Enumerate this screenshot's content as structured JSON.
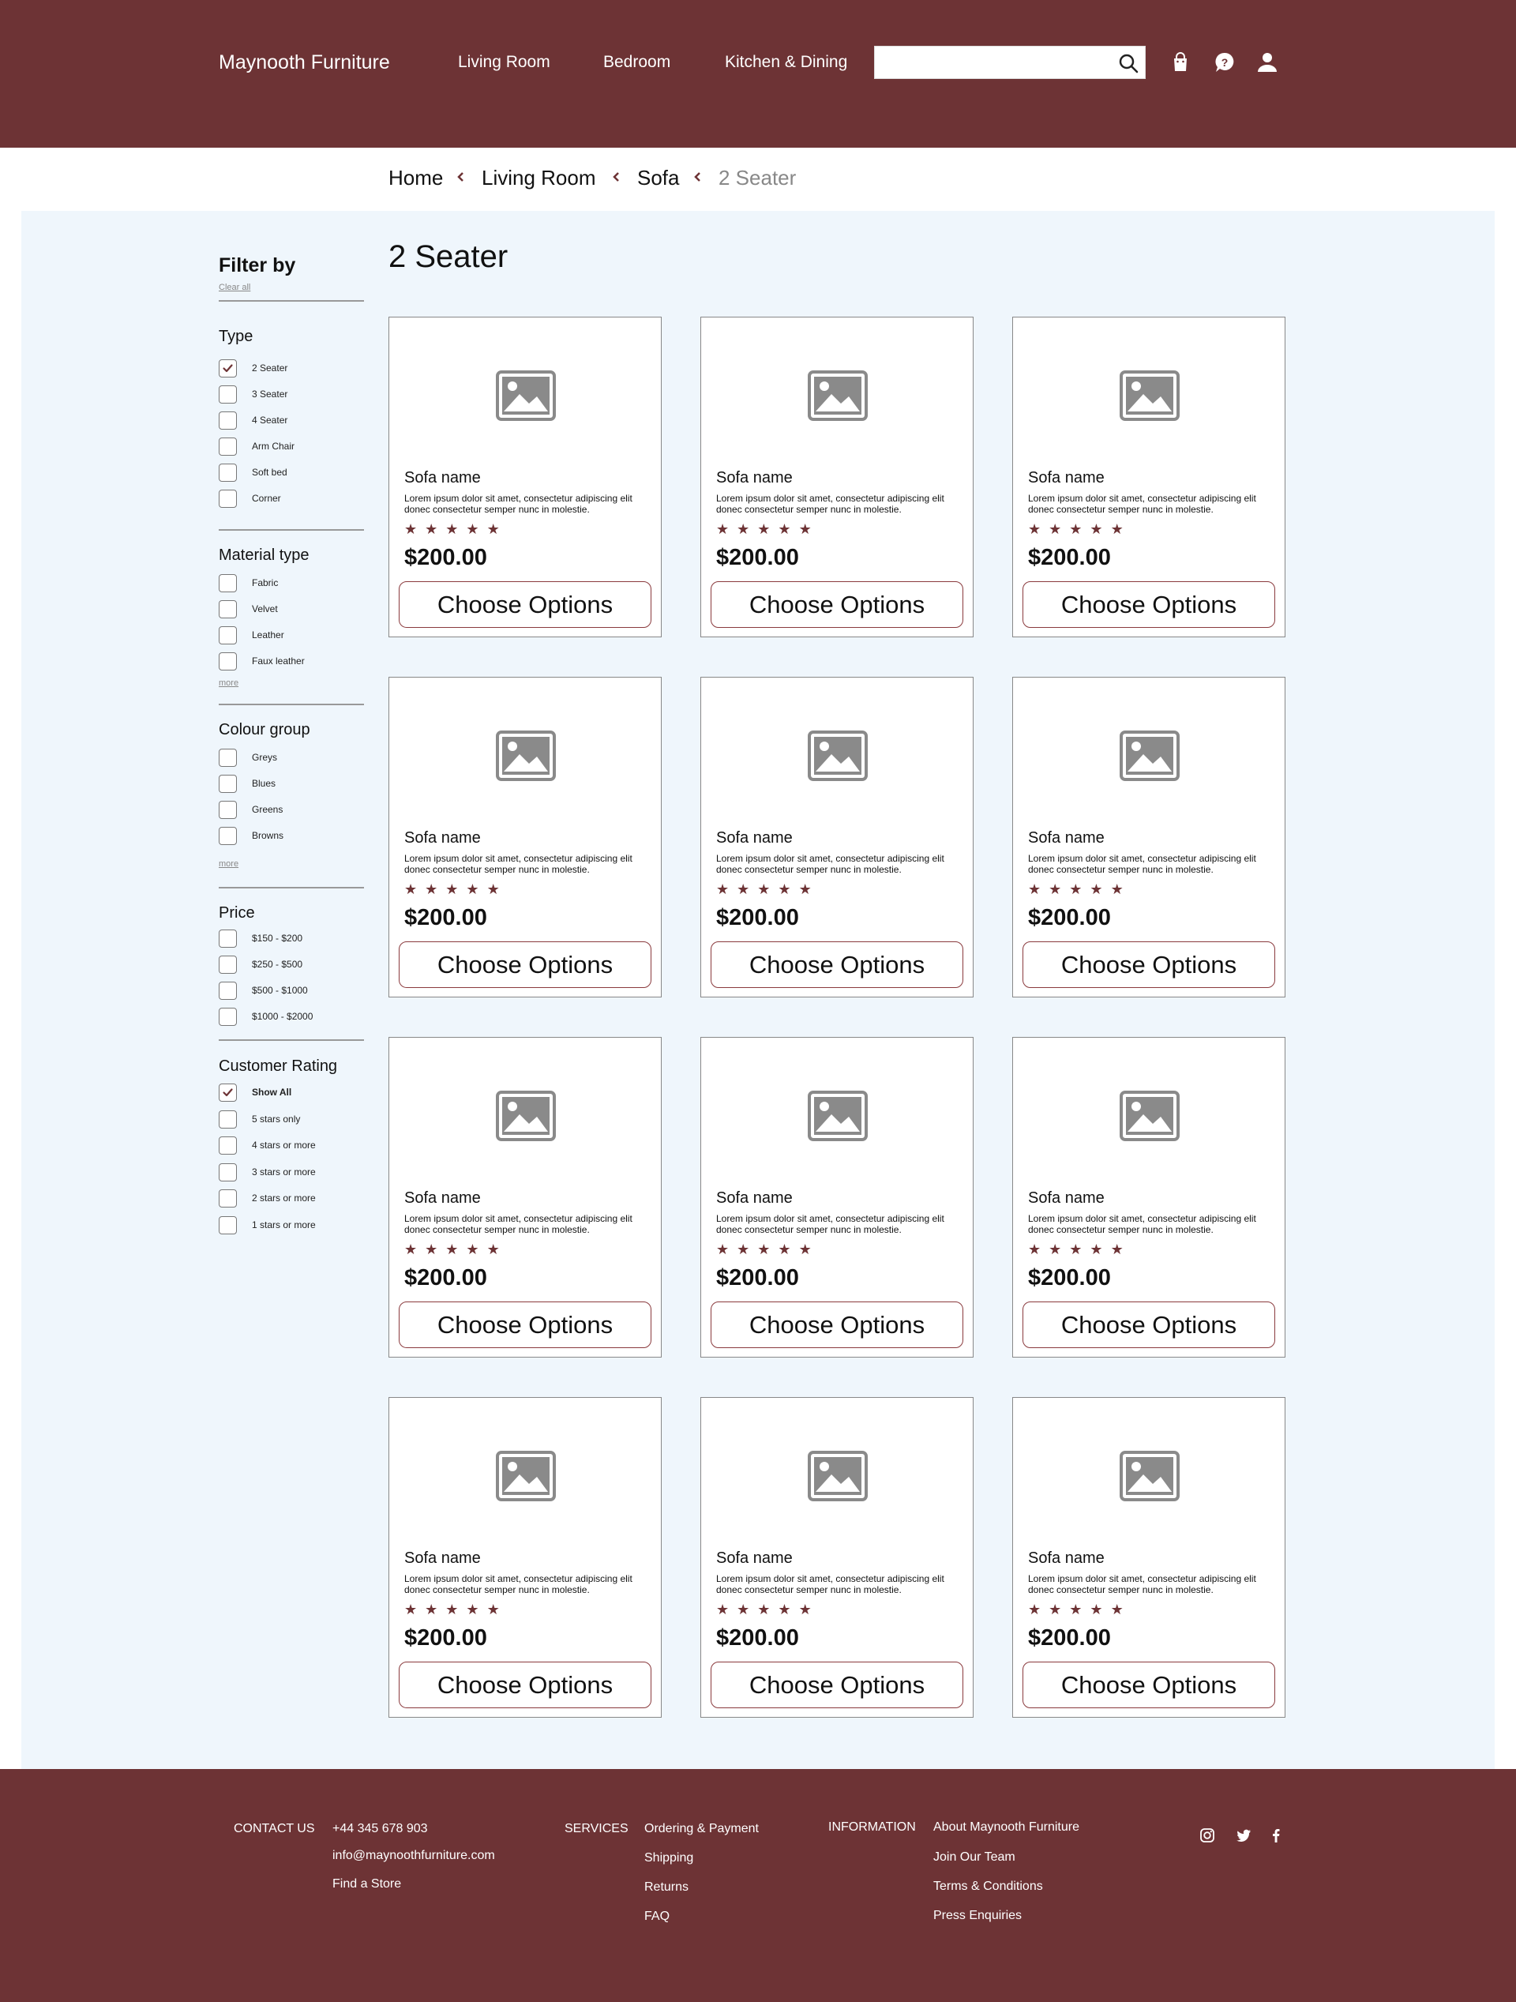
{
  "header": {
    "brand": "Maynooth Furniture",
    "nav": [
      "Living Room",
      "Bedroom",
      "Kitchen & Dining"
    ],
    "search": {
      "value": "",
      "placeholder": ""
    },
    "icons": [
      "search-icon",
      "shopping-bag-icon",
      "help-icon",
      "user-icon"
    ]
  },
  "breadcrumb": [
    "Home",
    "Living Room",
    "Sofa",
    "2 Seater"
  ],
  "page_title": "2 Seater",
  "filters": {
    "title": "Filter by",
    "clear_all": "Clear all",
    "more_label": "more",
    "type": {
      "title": "Type",
      "options": [
        {
          "label": "2 Seater",
          "checked": true
        },
        {
          "label": "3 Seater",
          "checked": false
        },
        {
          "label": "4 Seater",
          "checked": false
        },
        {
          "label": "Arm Chair",
          "checked": false
        },
        {
          "label": "Soft bed",
          "checked": false
        },
        {
          "label": "Corner",
          "checked": false
        }
      ]
    },
    "material": {
      "title": "Material type",
      "options": [
        {
          "label": "Fabric",
          "checked": false
        },
        {
          "label": "Velvet",
          "checked": false
        },
        {
          "label": "Leather",
          "checked": false
        },
        {
          "label": "Faux leather",
          "checked": false
        }
      ]
    },
    "colour": {
      "title": "Colour group",
      "options": [
        {
          "label": "Greys",
          "checked": false
        },
        {
          "label": "Blues",
          "checked": false
        },
        {
          "label": "Greens",
          "checked": false
        },
        {
          "label": "Browns",
          "checked": false
        }
      ]
    },
    "price": {
      "title": "Price",
      "options": [
        {
          "label": "$150 - $200",
          "checked": false
        },
        {
          "label": "$250 - $500",
          "checked": false
        },
        {
          "label": "$500 - $1000",
          "checked": false
        },
        {
          "label": "$1000 - $2000",
          "checked": false
        }
      ]
    },
    "rating": {
      "title": "Customer Rating",
      "options": [
        {
          "label": "Show All",
          "checked": true
        },
        {
          "label": "5 stars only",
          "checked": false
        },
        {
          "label": "4 stars or more",
          "checked": false
        },
        {
          "label": "3 stars or more",
          "checked": false
        },
        {
          "label": "2 stars or more",
          "checked": false
        },
        {
          "label": "1 stars or more",
          "checked": false
        }
      ]
    }
  },
  "products": [
    {
      "name": "Sofa name",
      "description": "Lorem ipsum dolor sit amet, consectetur adipiscing elit donec consectetur semper nunc in molestie.",
      "rating": 5,
      "price": "$200.00",
      "button": "Choose Options"
    },
    {
      "name": "Sofa name",
      "description": "Lorem ipsum dolor sit amet, consectetur adipiscing elit donec consectetur semper nunc in molestie.",
      "rating": 5,
      "price": "$200.00",
      "button": "Choose Options"
    },
    {
      "name": "Sofa name",
      "description": "Lorem ipsum dolor sit amet, consectetur adipiscing elit donec consectetur semper nunc in molestie.",
      "rating": 5,
      "price": "$200.00",
      "button": "Choose Options"
    },
    {
      "name": "Sofa name",
      "description": "Lorem ipsum dolor sit amet, consectetur adipiscing elit donec consectetur semper nunc in molestie.",
      "rating": 5,
      "price": "$200.00",
      "button": "Choose Options"
    },
    {
      "name": "Sofa name",
      "description": "Lorem ipsum dolor sit amet, consectetur adipiscing elit donec consectetur semper nunc in molestie.",
      "rating": 5,
      "price": "$200.00",
      "button": "Choose Options"
    },
    {
      "name": "Sofa name",
      "description": "Lorem ipsum dolor sit amet, consectetur adipiscing elit donec consectetur semper nunc in molestie.",
      "rating": 5,
      "price": "$200.00",
      "button": "Choose Options"
    },
    {
      "name": "Sofa name",
      "description": "Lorem ipsum dolor sit amet, consectetur adipiscing elit donec consectetur semper nunc in molestie.",
      "rating": 5,
      "price": "$200.00",
      "button": "Choose Options"
    },
    {
      "name": "Sofa name",
      "description": "Lorem ipsum dolor sit amet, consectetur adipiscing elit donec consectetur semper nunc in molestie.",
      "rating": 5,
      "price": "$200.00",
      "button": "Choose Options"
    },
    {
      "name": "Sofa name",
      "description": "Lorem ipsum dolor sit amet, consectetur adipiscing elit donec consectetur semper nunc in molestie.",
      "rating": 5,
      "price": "$200.00",
      "button": "Choose Options"
    },
    {
      "name": "Sofa name",
      "description": "Lorem ipsum dolor sit amet, consectetur adipiscing elit donec consectetur semper nunc in molestie.",
      "rating": 5,
      "price": "$200.00",
      "button": "Choose Options"
    },
    {
      "name": "Sofa name",
      "description": "Lorem ipsum dolor sit amet, consectetur adipiscing elit donec consectetur semper nunc in molestie.",
      "rating": 5,
      "price": "$200.00",
      "button": "Choose Options"
    },
    {
      "name": "Sofa name",
      "description": "Lorem ipsum dolor sit amet, consectetur adipiscing elit donec consectetur semper nunc in molestie.",
      "rating": 5,
      "price": "$200.00",
      "button": "Choose Options"
    }
  ],
  "footer": {
    "contact": {
      "heading": "CONTACT US",
      "phone": "+44 345 678 903",
      "email": "info@maynoothfurniture.com",
      "store": "Find a Store"
    },
    "services": {
      "heading": "SERVICES",
      "links": [
        "Ordering & Payment",
        "Shipping",
        "Returns",
        "FAQ"
      ]
    },
    "information": {
      "heading": "INFORMATION",
      "links": [
        "About Maynooth Furniture",
        "Join Our Team",
        "Terms & Conditions",
        "Press Enquiries"
      ]
    },
    "social": [
      "instagram-icon",
      "twitter-icon",
      "facebook-icon"
    ]
  },
  "colors": {
    "brand": "#6d3335",
    "page_background": "#eff6fc",
    "star": "#6d3335",
    "button_border": "#8a3a3d"
  }
}
